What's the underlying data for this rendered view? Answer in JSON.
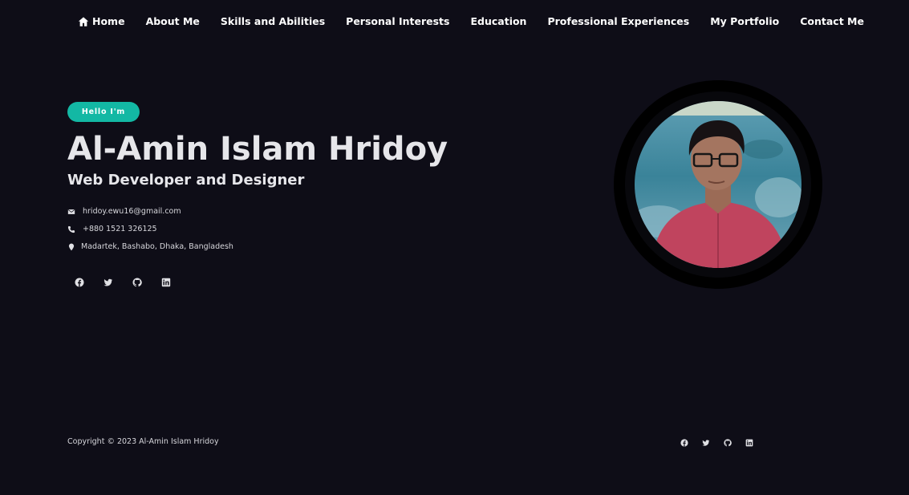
{
  "nav": {
    "items": [
      {
        "label": "Home",
        "icon": "home-icon"
      },
      {
        "label": "About Me"
      },
      {
        "label": "Skills and Abilities"
      },
      {
        "label": "Personal Interests"
      },
      {
        "label": "Education"
      },
      {
        "label": "Professional Experiences"
      },
      {
        "label": "My Portfolio"
      },
      {
        "label": "Contact Me"
      }
    ]
  },
  "hero": {
    "badge": "Hello I'm",
    "name": "Al-Amin Islam Hridoy",
    "role": "Web Developer and Designer",
    "contacts": {
      "email": "hridoy.ewu16@gmail.com",
      "phone": "+880 1521 326125",
      "address": "Madartek, Bashabo, Dhaka, Bangladesh"
    },
    "socials": [
      "facebook-icon",
      "twitter-icon",
      "github-icon",
      "linkedin-icon"
    ]
  },
  "footer": {
    "copyright": "Copyright © 2023 Al-Amin Islam Hridoy",
    "socials": [
      "facebook-icon",
      "twitter-icon",
      "github-icon",
      "linkedin-icon"
    ]
  },
  "colors": {
    "background": "#0e0d17",
    "accent": "#13b8a4",
    "text": "#ffffff"
  }
}
